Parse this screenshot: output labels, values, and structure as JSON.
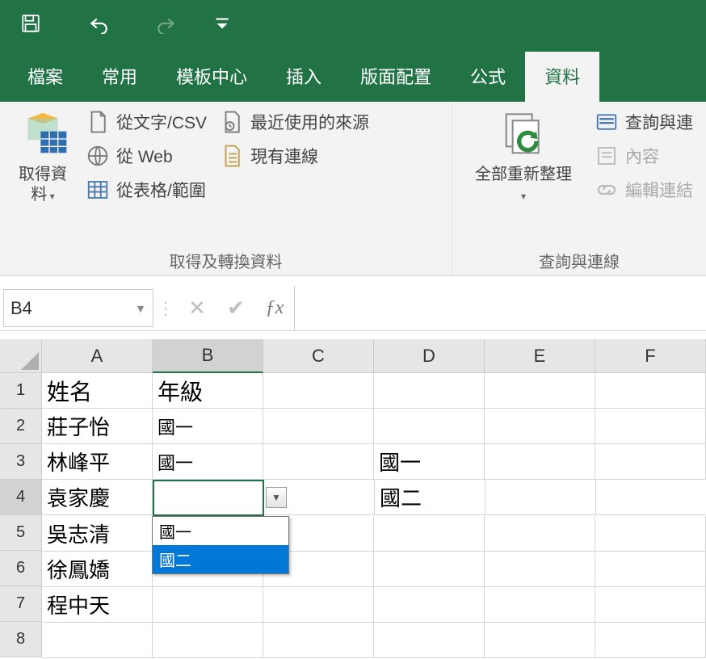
{
  "quickAccess": {
    "save": "save",
    "undo": "undo",
    "redo": "redo",
    "customize": "customize"
  },
  "tabs": {
    "file": "檔案",
    "home": "常用",
    "template": "模板中心",
    "insert": "插入",
    "layout": "版面配置",
    "formula": "公式",
    "data": "資料"
  },
  "ribbon": {
    "group1": {
      "getDataL1": "取得資",
      "getDataL2": "料",
      "fromCsv": "從文字/CSV",
      "fromWeb": "從 Web",
      "fromTable": "從表格/範圍",
      "recentSources": "最近使用的來源",
      "existingConn": "現有連線",
      "label": "取得及轉換資料"
    },
    "group2": {
      "refreshAll": "全部重新整理",
      "queries": "查詢與連",
      "properties": "內容",
      "editLinks": "編輯連結",
      "label": "查詢與連線"
    }
  },
  "formulaBar": {
    "name": "B4",
    "value": ""
  },
  "columns": [
    "A",
    "B",
    "C",
    "D",
    "E",
    "F"
  ],
  "rows": [
    "1",
    "2",
    "3",
    "4",
    "5",
    "6",
    "7",
    "8"
  ],
  "cells": {
    "A1": "姓名",
    "B1": "年級",
    "A2": "莊子怡",
    "B2": "國一",
    "A3": "林峰平",
    "B3": "國一",
    "A4": "袁家慶",
    "A5": "吳志清",
    "A6": "徐鳳嬌",
    "A7": "程中天",
    "D3": "國一",
    "D4": "國二"
  },
  "validationList": {
    "opt1": "國一",
    "opt2": "國二"
  }
}
